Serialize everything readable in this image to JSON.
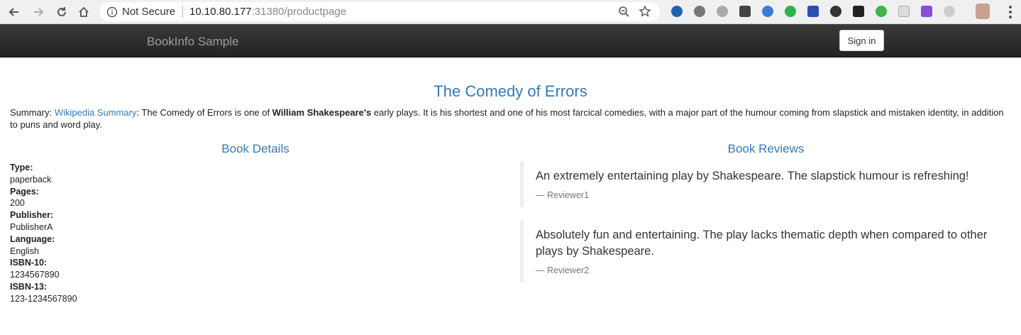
{
  "browser": {
    "security_label": "Not Secure",
    "url_host": "10.10.80.177",
    "url_path": ":31380/productpage",
    "extension_icons": [
      "y-icon",
      "gear-ext-icon",
      "chat-ext-icon",
      "pocket-icon",
      "globe-ext-icon",
      "d-ext-icon",
      "flag-ext-icon",
      "record-ext-icon",
      "x-ext-icon",
      "evernote-icon",
      "card-ext-icon",
      "feather-ext-icon",
      "circle-ext-icon",
      "profile-avatar"
    ]
  },
  "navbar": {
    "brand": "BookInfo Sample",
    "signin_label": "Sign in"
  },
  "product": {
    "title": "The Comedy of Errors",
    "summary_prefix": "Summary: ",
    "summary_link": "Wikipedia Summary",
    "summary_text_1": ": The Comedy of Errors is one of ",
    "summary_bold": "William Shakespeare's",
    "summary_text_2": " early plays. It is his shortest and one of his most farcical comedies, with a major part of the humour coming from slapstick and mistaken identity, in addition to puns and word play."
  },
  "details": {
    "heading": "Book Details",
    "fields": [
      {
        "label": "Type:",
        "value": "paperback"
      },
      {
        "label": "Pages:",
        "value": "200"
      },
      {
        "label": "Publisher:",
        "value": "PublisherA"
      },
      {
        "label": "Language:",
        "value": "English"
      },
      {
        "label": "ISBN-10:",
        "value": "1234567890"
      },
      {
        "label": "ISBN-13:",
        "value": "123-1234567890"
      }
    ]
  },
  "reviews": {
    "heading": "Book Reviews",
    "items": [
      {
        "text": "An extremely entertaining play by Shakespeare. The slapstick humour is refreshing!",
        "reviewer": "— Reviewer1"
      },
      {
        "text": "Absolutely fun and entertaining. The play lacks thematic depth when compared to other plays by Shakespeare.",
        "reviewer": "— Reviewer2"
      }
    ]
  }
}
